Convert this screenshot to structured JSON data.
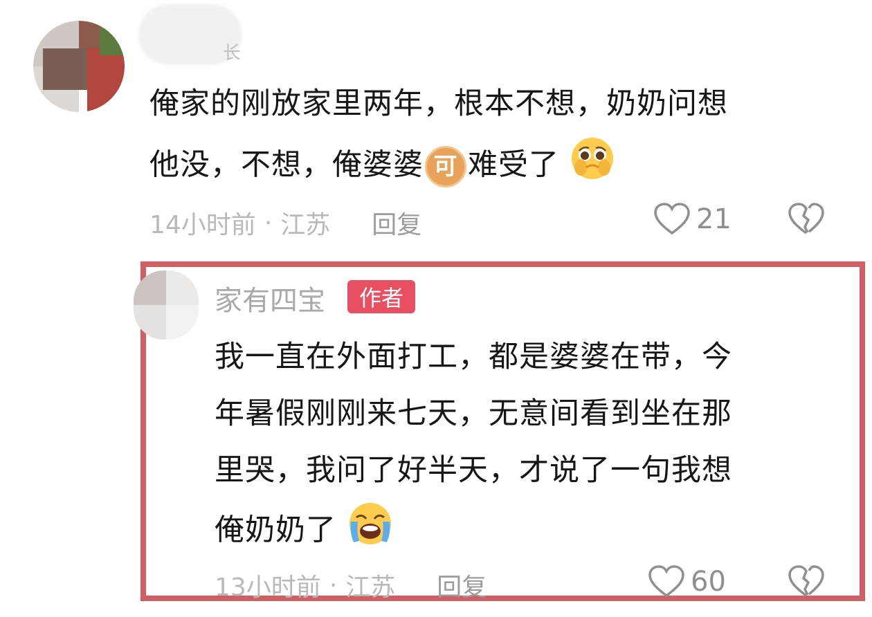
{
  "colors": {
    "highlight_border": "#cf5f65",
    "author_badge": "#e84f62",
    "meta_text": "#b9b9b9"
  },
  "comment": {
    "avatar": "blurred-avatar",
    "username_suffix": "长",
    "text_line1": "俺家的刚放家里两年，根本不想，奶奶问想",
    "text_line2a": "他没，不想，俺婆婆",
    "text_badge": "可",
    "text_line2b": "难受了",
    "emoji": "pleading-face-emoji",
    "time": "14小时前",
    "dot": "·",
    "location": "江苏",
    "reply_label": "回复",
    "like_count": "21"
  },
  "reply": {
    "author_name": "家有四宝",
    "author_badge": "作者",
    "text_line1": "我一直在外面打工，都是婆婆在带，今",
    "text_line2": "年暑假刚刚来七天，无意间看到坐在那",
    "text_line3": "里哭，我问了好半天，才说了一句我想",
    "text_line4": "俺奶奶了",
    "emoji": "loudly-crying-face-emoji",
    "time": "13小时前",
    "dot": "·",
    "location": "江苏",
    "reply_label": "回复",
    "like_count": "60"
  }
}
